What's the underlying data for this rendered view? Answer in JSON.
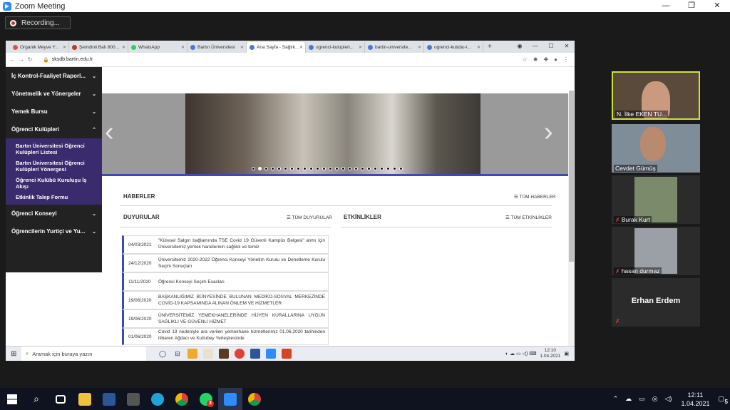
{
  "zoom": {
    "title": "Zoom Meeting",
    "recording": "Recording..."
  },
  "browser": {
    "tabs": [
      "Organik Meyve Y...",
      "Şemdinli Balı 800...",
      "WhatsApp",
      "Bartın Üniversitesi",
      "Ana Sayfa - Sağlık...",
      "ogrenci-kulupleri...",
      "bartin-universite...",
      "ogrenci-kulubu-i..."
    ],
    "active_tab": 4,
    "url": "sksdb.bartin.edu.tr"
  },
  "sidebar": {
    "items": [
      {
        "label": "İç Kontrol-Faaliyet Raporl...",
        "chev": "⌄"
      },
      {
        "label": "Yönetmelik ve Yönergeler",
        "chev": "⌄"
      },
      {
        "label": "Yemek Bursu",
        "chev": "⌄"
      },
      {
        "label": "Öğrenci Kulüpleri",
        "chev": "⌃"
      }
    ],
    "subitems": [
      "Bartın Üniversitesi Öğrenci Kulüpleri Listesi",
      "Bartın Üniversitesi Öğrenci Kulüpleri Yönergesi",
      "Öğrenci Kulübü Kuruluşu İş Akışı",
      "Etkinlik Talep Formu"
    ],
    "items_after": [
      {
        "label": "Öğrenci Konseyi",
        "chev": "⌄"
      },
      {
        "label": "Öğrencilerin Yurtiçi ve Yu...",
        "chev": "⌄"
      }
    ]
  },
  "sections": {
    "news": "HABERLER",
    "news_all": "☰ TÜM HABERLER",
    "announcements": "DUYURULAR",
    "announcements_all": "☰ TÜM DUYURULAR",
    "events": "ETKİNLİKLER",
    "events_all": "☰ TÜM ETKİNLİKLER"
  },
  "announcements": [
    {
      "date": "04/03/2021",
      "text": "\"Küresel Salgın bağlamında TSE Covid 19 Güvenli Kampüs Belgesi\" alımı için Üniversitemiz yemek hanelerinin sağlıklı ve temiz"
    },
    {
      "date": "24/12/2020",
      "text": "Üniversitemiz 2020-2022 Öğrenci Konseyi Yönetim Kurulu ve Denetleme Kurulu Seçim Sonuçları"
    },
    {
      "date": "11/11/2020",
      "text": "Öğrenci Konseyi Seçim Esasları"
    },
    {
      "date": "19/06/2020",
      "text": "BAŞKANLIĞIMIZ BÜNYESİNDE BULUNAN MEDİKO-SOSYAL MERKEZİNDE COVİD-19 KAPSAMINDA ALINAN ÖNLEM VE HİZMETLER"
    },
    {
      "date": "19/06/2020",
      "text": "ÜNİVERSİTEMİZ YEMEKHANELERİNDE HİJYEN KURALLARINA UYGUN SAĞLIKLI VE GÜVENLİ HİZMET"
    },
    {
      "date": "01/06/2020",
      "text": "Covid 19 nedeniyle ara verilen yemekhane hizmetlerimiz 01.06.2020 tarihinden itibaren Ağdacı ve Kutlubey Yerleşkesinde"
    }
  ],
  "inner_taskbar": {
    "search": "Aramak için buraya yazın",
    "time": "12:10",
    "date": "1.04.2021"
  },
  "participants": [
    {
      "name": "N. İlke EKEN TU...",
      "muted": false
    },
    {
      "name": "Cevdet Gümüş",
      "muted": false
    },
    {
      "name": "Burak Kurt",
      "muted": true
    },
    {
      "name": "hasan durmaz",
      "muted": true
    },
    {
      "name": "Erhan Erdem",
      "muted": true
    }
  ],
  "taskbar": {
    "time": "12:11",
    "date": "1.04.2021",
    "notif": "5",
    "whatsapp_badge": "3"
  }
}
